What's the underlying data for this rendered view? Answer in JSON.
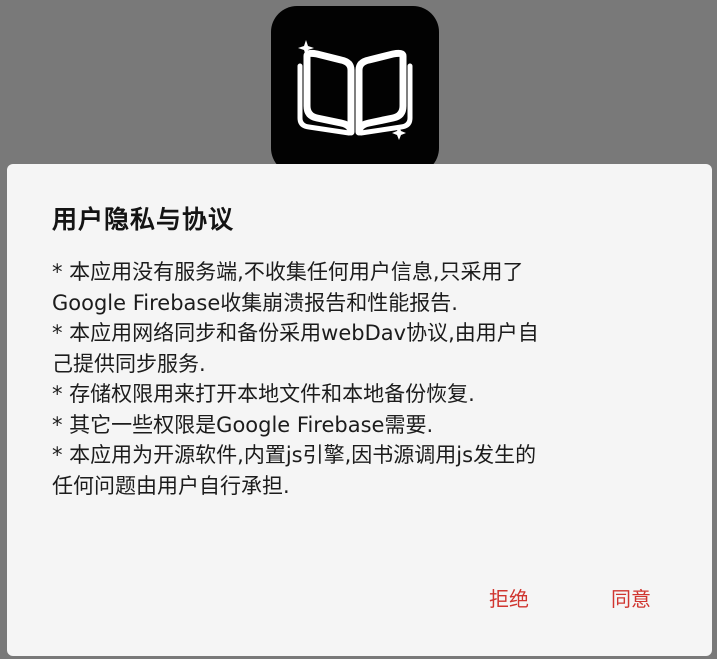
{
  "background": {
    "scrim_color": "#797979",
    "app_icon": "open-book-icon"
  },
  "dialog": {
    "title": "用户隐私与协议",
    "body_lines": [
      "* 本应用没有服务端,不收集任何用户信息,只采用了",
      "Google Firebase收集崩溃报告和性能报告.",
      "* 本应用网络同步和备份采用webDav协议,由用户自",
      "己提供同步服务.",
      "* 存储权限用来打开本地文件和本地备份恢复.",
      "* 其它一些权限是Google Firebase需要.",
      "* 本应用为开源软件,内置js引擎,因书源调用js发生的",
      "任何问题由用户自行承担."
    ],
    "reject_label": "拒绝",
    "agree_label": "同意",
    "accent_color": "#d0352f"
  }
}
